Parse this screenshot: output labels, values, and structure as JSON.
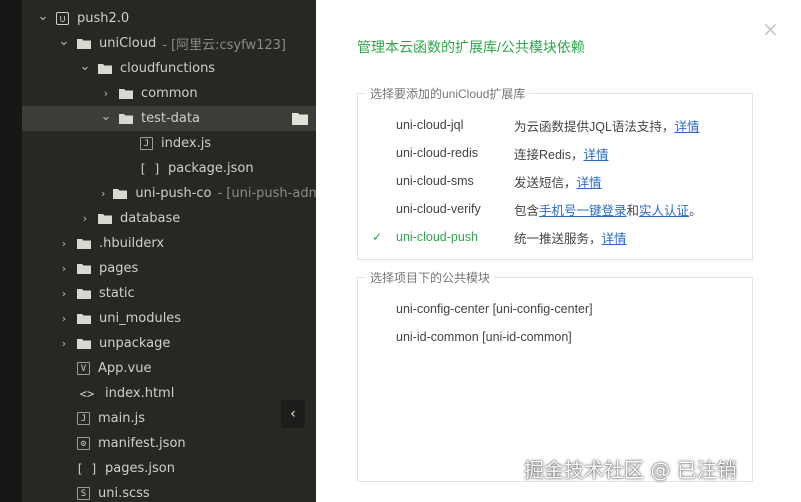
{
  "explorer": {
    "rows": [
      {
        "label": "push2.0",
        "chevron": "open",
        "icon": "project-icon",
        "level": 0
      },
      {
        "label": "uniCloud",
        "annot": "- [阿里云:csyfw123]",
        "chevron": "open",
        "icon": "folder-icon",
        "level": 1
      },
      {
        "label": "cloudfunctions",
        "chevron": "open",
        "icon": "folder-icon",
        "level": 2
      },
      {
        "label": "common",
        "chevron": "closed",
        "icon": "folder-icon",
        "level": 3
      },
      {
        "label": "test-data",
        "chevron": "open",
        "icon": "folder-icon",
        "level": 3,
        "selected": true
      },
      {
        "label": "index.js",
        "chevron": "none",
        "icon": "js-file-icon",
        "level": 4
      },
      {
        "label": "package.json",
        "chevron": "none",
        "icon": "json-file-icon",
        "level": 4
      },
      {
        "label": "uni-push-co",
        "annot": "- [uni-push-adm",
        "chevron": "closed",
        "icon": "folder-icon",
        "level": 3
      },
      {
        "label": "database",
        "chevron": "closed",
        "icon": "folder-icon",
        "level": 2
      },
      {
        "label": ".hbuilderx",
        "chevron": "closed",
        "icon": "folder-icon",
        "level": 1
      },
      {
        "label": "pages",
        "chevron": "closed",
        "icon": "folder-icon",
        "level": 1
      },
      {
        "label": "static",
        "chevron": "closed",
        "icon": "folder-icon",
        "level": 1
      },
      {
        "label": "uni_modules",
        "chevron": "closed",
        "icon": "folder-icon",
        "level": 1
      },
      {
        "label": "unpackage",
        "chevron": "closed",
        "icon": "folder-icon",
        "level": 1
      },
      {
        "label": "App.vue",
        "chevron": "none",
        "icon": "vue-file-icon",
        "level": 1
      },
      {
        "label": "index.html",
        "chevron": "none",
        "icon": "html-file-icon",
        "level": 1
      },
      {
        "label": "main.js",
        "chevron": "none",
        "icon": "js-file-icon",
        "level": 1
      },
      {
        "label": "manifest.json",
        "chevron": "none",
        "icon": "manifest-file-icon",
        "level": 1
      },
      {
        "label": "pages.json",
        "chevron": "none",
        "icon": "json-file-icon",
        "level": 1
      },
      {
        "label": "uni.scss",
        "chevron": "none",
        "icon": "scss-file-icon",
        "level": 1
      }
    ],
    "collapse_icon": "‹"
  },
  "dialog": {
    "title": "管理本云函数的扩展库/公共模块依赖",
    "close_icon": "×",
    "extensions_legend": "选择要添加的uniCloud扩展库",
    "extensions": [
      {
        "name": "uni-cloud-jql",
        "checked": false,
        "desc_parts": [
          {
            "t": "为云函数提供JQL语法支持，"
          },
          {
            "t": "详情",
            "link": true
          }
        ]
      },
      {
        "name": "uni-cloud-redis",
        "checked": false,
        "desc_parts": [
          {
            "t": "连接Redis，"
          },
          {
            "t": "详情",
            "link": true
          }
        ]
      },
      {
        "name": "uni-cloud-sms",
        "checked": false,
        "desc_parts": [
          {
            "t": "发送短信，"
          },
          {
            "t": "详情",
            "link": true
          }
        ]
      },
      {
        "name": "uni-cloud-verify",
        "checked": false,
        "desc_parts": [
          {
            "t": "包含"
          },
          {
            "t": "手机号一键登录",
            "link": true
          },
          {
            "t": "和"
          },
          {
            "t": "实人认证",
            "link": true
          },
          {
            "t": "。"
          }
        ]
      },
      {
        "name": "uni-cloud-push",
        "checked": true,
        "desc_parts": [
          {
            "t": "统一推送服务，"
          },
          {
            "t": "详情",
            "link": true
          }
        ]
      }
    ],
    "modules_legend": "选择项目下的公共模块",
    "modules": [
      {
        "label": "uni-config-center [uni-config-center]"
      },
      {
        "label": "uni-id-common [uni-id-common]"
      }
    ]
  },
  "watermark": "掘金技术社区 @ 已注销",
  "colors": {
    "accent_green": "#2fa84d",
    "link_blue": "#2b6cc2",
    "explorer_bg": "#262824"
  }
}
